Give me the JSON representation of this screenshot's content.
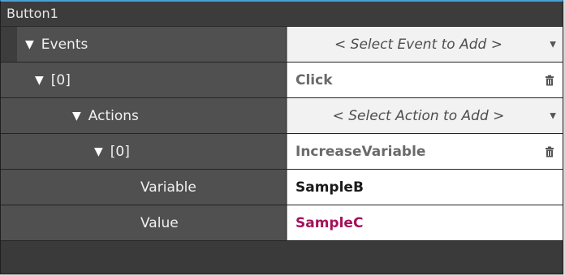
{
  "title": "Button1",
  "rows": [
    {
      "label": "Events",
      "value": "< Select Event to Add >",
      "type": "select",
      "expanded": true
    },
    {
      "label": "[0]",
      "value": "Click",
      "type": "item",
      "expanded": true
    },
    {
      "label": "Actions",
      "value": "< Select Action to Add >",
      "type": "select",
      "expanded": true
    },
    {
      "label": "[0]",
      "value": "IncreaseVariable",
      "type": "item",
      "expanded": true
    },
    {
      "label": "Variable",
      "value": "SampleB",
      "type": "value"
    },
    {
      "label": "Value",
      "value": "SampleC",
      "type": "value",
      "color": "#a3125a"
    }
  ],
  "icons": {
    "expand": "triangle-down-icon",
    "dropdown": "chevron-down-icon",
    "delete": "trash-icon"
  }
}
